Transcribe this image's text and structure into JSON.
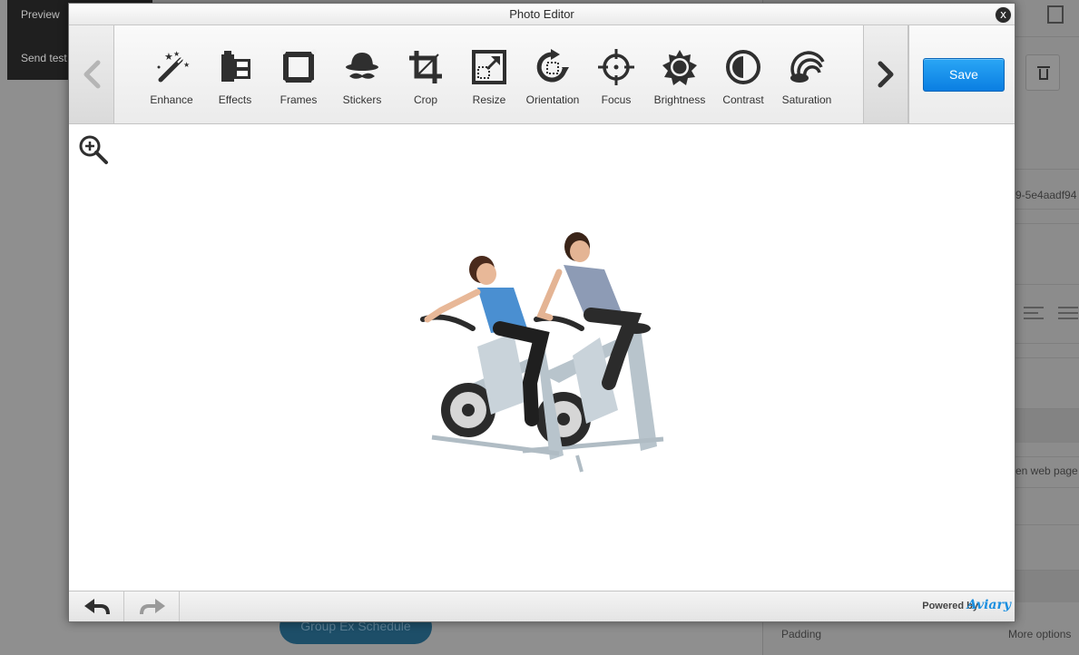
{
  "background": {
    "menu": {
      "preview_label": "Preview",
      "send_test_label": "Send test"
    },
    "right_panel": {
      "id_fragment": "9-5e4aadf94",
      "link_fragment": "en web page",
      "padding_label": "Padding",
      "more_options_label": "More options"
    },
    "schedule_button_label": "Group Ex Schedule"
  },
  "modal": {
    "title": "Photo Editor",
    "close_label": "x",
    "toolbar": {
      "tools": [
        {
          "label": "Enhance",
          "icon": "magic-wand-icon"
        },
        {
          "label": "Effects",
          "icon": "film-icon"
        },
        {
          "label": "Frames",
          "icon": "frame-icon"
        },
        {
          "label": "Stickers",
          "icon": "hat-mustache-icon"
        },
        {
          "label": "Crop",
          "icon": "crop-icon"
        },
        {
          "label": "Resize",
          "icon": "resize-icon"
        },
        {
          "label": "Orientation",
          "icon": "rotate-icon"
        },
        {
          "label": "Focus",
          "icon": "focus-icon"
        },
        {
          "label": "Brightness",
          "icon": "sun-icon"
        },
        {
          "label": "Contrast",
          "icon": "contrast-icon"
        },
        {
          "label": "Saturation",
          "icon": "saturation-icon"
        }
      ],
      "save_label": "Save"
    },
    "footer": {
      "powered_by": "Powered by",
      "brand": "Aviary"
    }
  },
  "colors": {
    "accent": "#0a7ee2",
    "icon": "#2f2f2f",
    "nav_arrow_disabled": "#b5b5b5",
    "nav_arrow_enabled": "#333333"
  }
}
